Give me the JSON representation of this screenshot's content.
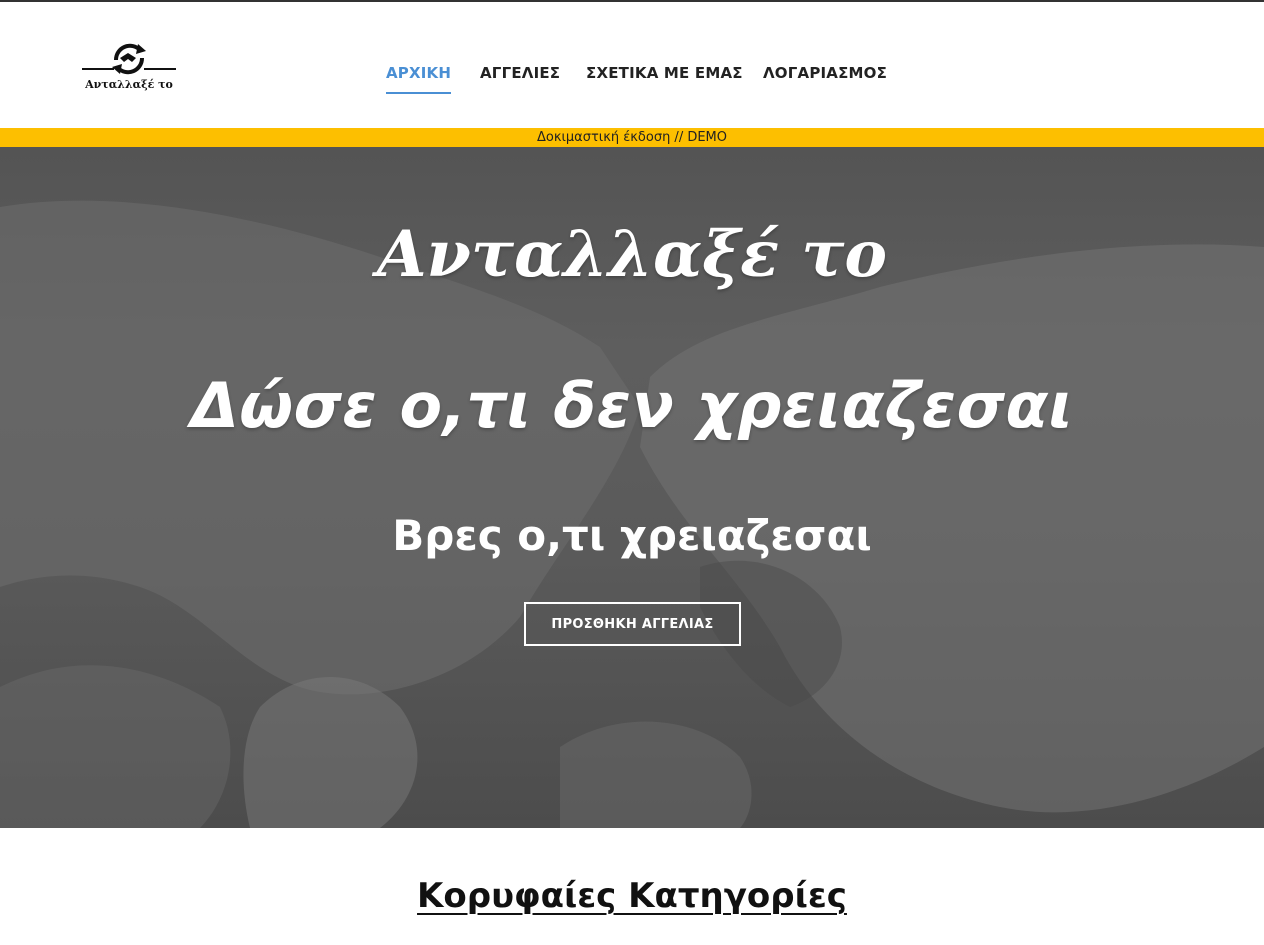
{
  "brand": {
    "logo_text": "Ανταλλαξέ το",
    "logo_icon": "handshake-swap-icon"
  },
  "nav": {
    "items": [
      {
        "label": "ΑΡΧΙΚΗ",
        "active": true
      },
      {
        "label": "ΑΓΓΕΛΙΕΣ",
        "active": false
      },
      {
        "label": "ΣΧΕΤΙΚΑ ΜΕ ΕΜΑΣ",
        "active": false
      },
      {
        "label": "ΛΟΓΑΡΙΑΣΜΟΣ",
        "active": false
      }
    ]
  },
  "demo_banner": "Δοκιμαστική έκδοση // DEMO",
  "hero": {
    "title": "Ανταλλαξέ το",
    "subtitle_1": "Δώσε ο,τι δεν χρειαζεσαι",
    "subtitle_2": "Βρες ο,τι χρειαζεσαι",
    "cta_label": "ΠΡΟΣΘΗΚΗ ΑΓΓΕΛΙΑΣ"
  },
  "sections": {
    "categories_title": "Κορυφαίες Κατηγορίες"
  },
  "colors": {
    "accent": "#4a8fd4",
    "demo_banner": "#fdbf00",
    "hero_overlay": "#555555"
  }
}
